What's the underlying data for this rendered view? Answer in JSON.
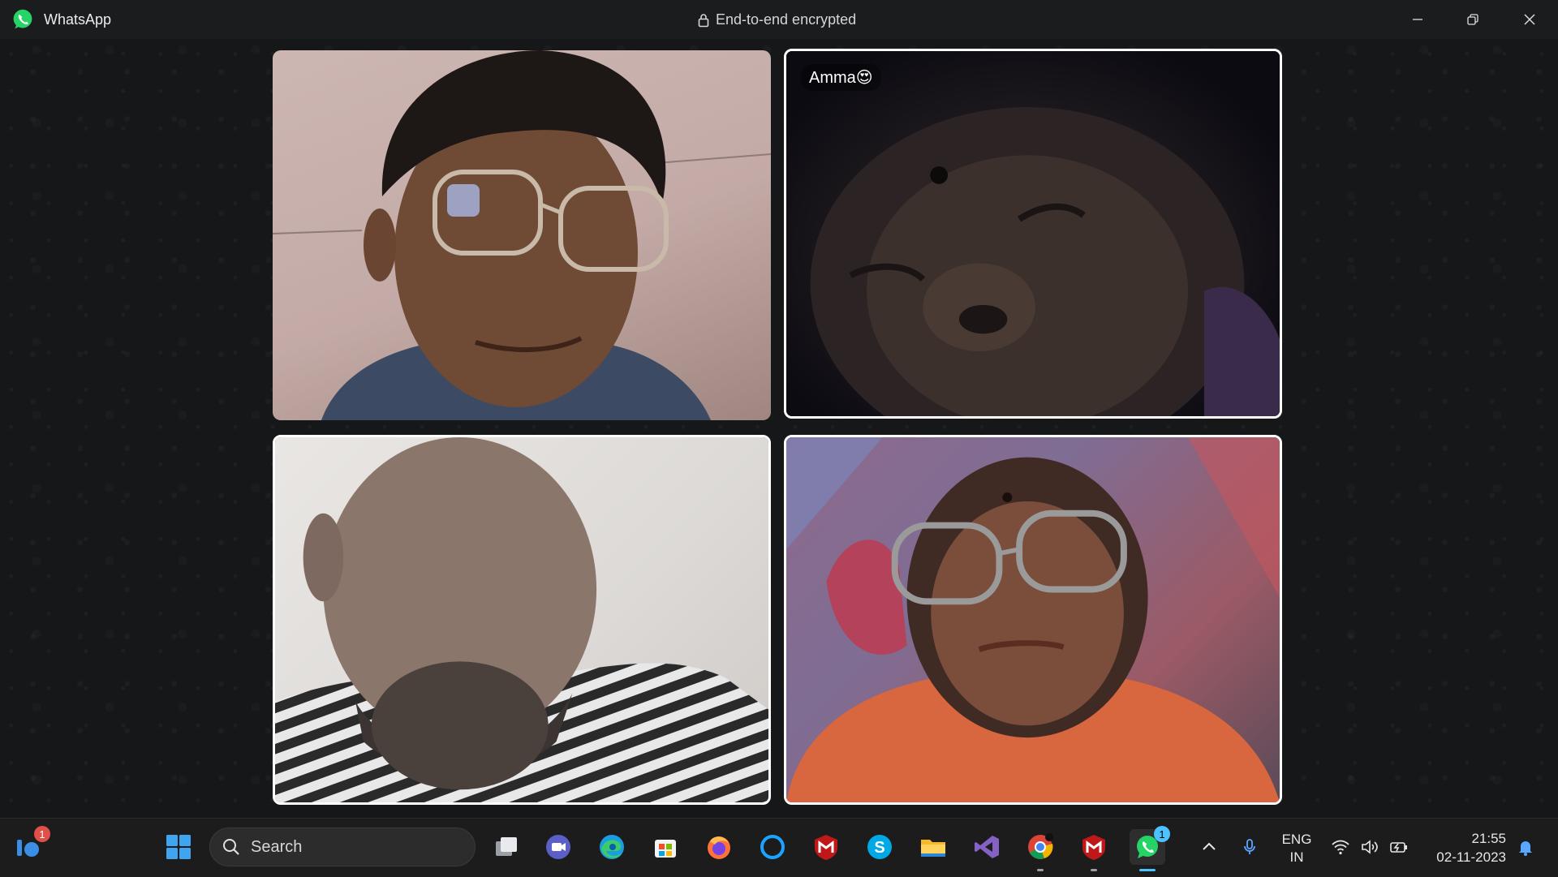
{
  "window": {
    "app_name": "WhatsApp",
    "encryption_label": "End-to-end encrypted"
  },
  "call": {
    "participants": [
      {
        "name": "",
        "active": false
      },
      {
        "name": "Amma😍",
        "active": true
      },
      {
        "name": "",
        "active": true
      },
      {
        "name": "",
        "active": true
      }
    ]
  },
  "taskbar": {
    "search_label": "Search",
    "widgets_badge": "1",
    "whatsapp_badge": "1",
    "apps": [
      "start-icon",
      "task-view-icon",
      "teams-meet-icon",
      "edge-icon",
      "microsoft-store-icon",
      "firefox-icon",
      "cortana-icon",
      "mcafee-icon",
      "skype-icon",
      "file-explorer-icon",
      "visual-studio-icon",
      "chrome-icon",
      "mcafee-icon",
      "whatsapp-icon"
    ]
  },
  "tray": {
    "lang_line1": "ENG",
    "lang_line2": "IN",
    "time": "21:55",
    "date": "02-11-2023"
  },
  "colors": {
    "titlebar": "#1b1c1d",
    "stage": "#161718",
    "taskbar": "#1c1c1c",
    "whatsapp_green": "#25d366",
    "focus_accent": "#4cc2ff",
    "badge": "#e0504a"
  }
}
